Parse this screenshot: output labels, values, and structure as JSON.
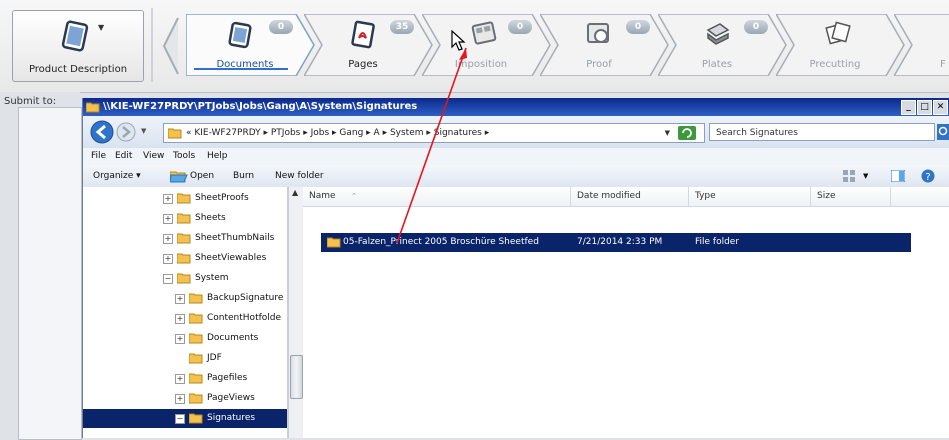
{
  "workflow": {
    "product_description_label": "Product Description",
    "steps": [
      {
        "label": "Documents",
        "count": "0"
      },
      {
        "label": "Pages",
        "count": "35"
      },
      {
        "label": "Imposition",
        "count": "0"
      },
      {
        "label": "Proof",
        "count": "0"
      },
      {
        "label": "Plates",
        "count": "0"
      },
      {
        "label": "Precutting",
        "count": ""
      },
      {
        "label": "F",
        "count": ""
      }
    ]
  },
  "submit_label": "Submit to:",
  "explorer": {
    "title": "\\\\KIE-WF27PRDY\\PTJobs\\Jobs\\Gang\\A\\System\\Signatures",
    "breadcrumb": "« KIE-WF27PRDY ▸ PTJobs ▸ Jobs ▸ Gang ▸ A ▸ System ▸ Signatures ▸",
    "search_placeholder": "Search Signatures",
    "menu": [
      "File",
      "Edit",
      "View",
      "Tools",
      "Help"
    ],
    "commands": {
      "organize": "Organize ▾",
      "open": "Open",
      "burn": "Burn",
      "new_folder": "New folder"
    },
    "tree": [
      {
        "label": "SheetProofs",
        "exp": "+"
      },
      {
        "label": "Sheets",
        "exp": "+"
      },
      {
        "label": "SheetThumbNails",
        "exp": "+"
      },
      {
        "label": "SheetViewables",
        "exp": "+"
      },
      {
        "label": "System",
        "exp": "−"
      },
      {
        "label": "BackupSignature",
        "exp": "+"
      },
      {
        "label": "ContentHotfolde",
        "exp": "+"
      },
      {
        "label": "Documents",
        "exp": "+"
      },
      {
        "label": "JDF",
        "exp": ""
      },
      {
        "label": "Pagefiles",
        "exp": "+"
      },
      {
        "label": "PageViews",
        "exp": "+"
      },
      {
        "label": "Signatures",
        "exp": "−"
      }
    ],
    "columns": {
      "name": "Name",
      "date": "Date modified",
      "type": "Type",
      "size": "Size"
    },
    "file": {
      "name": "05-Falzen_Prinect 2005 Broschüre Sheetfed",
      "date": "7/21/2014 2:33 PM",
      "type": "File folder"
    }
  },
  "colors": {
    "title_bar": "#0b2a8a",
    "selection": "#0a246a",
    "arrow": "#e8141c"
  }
}
